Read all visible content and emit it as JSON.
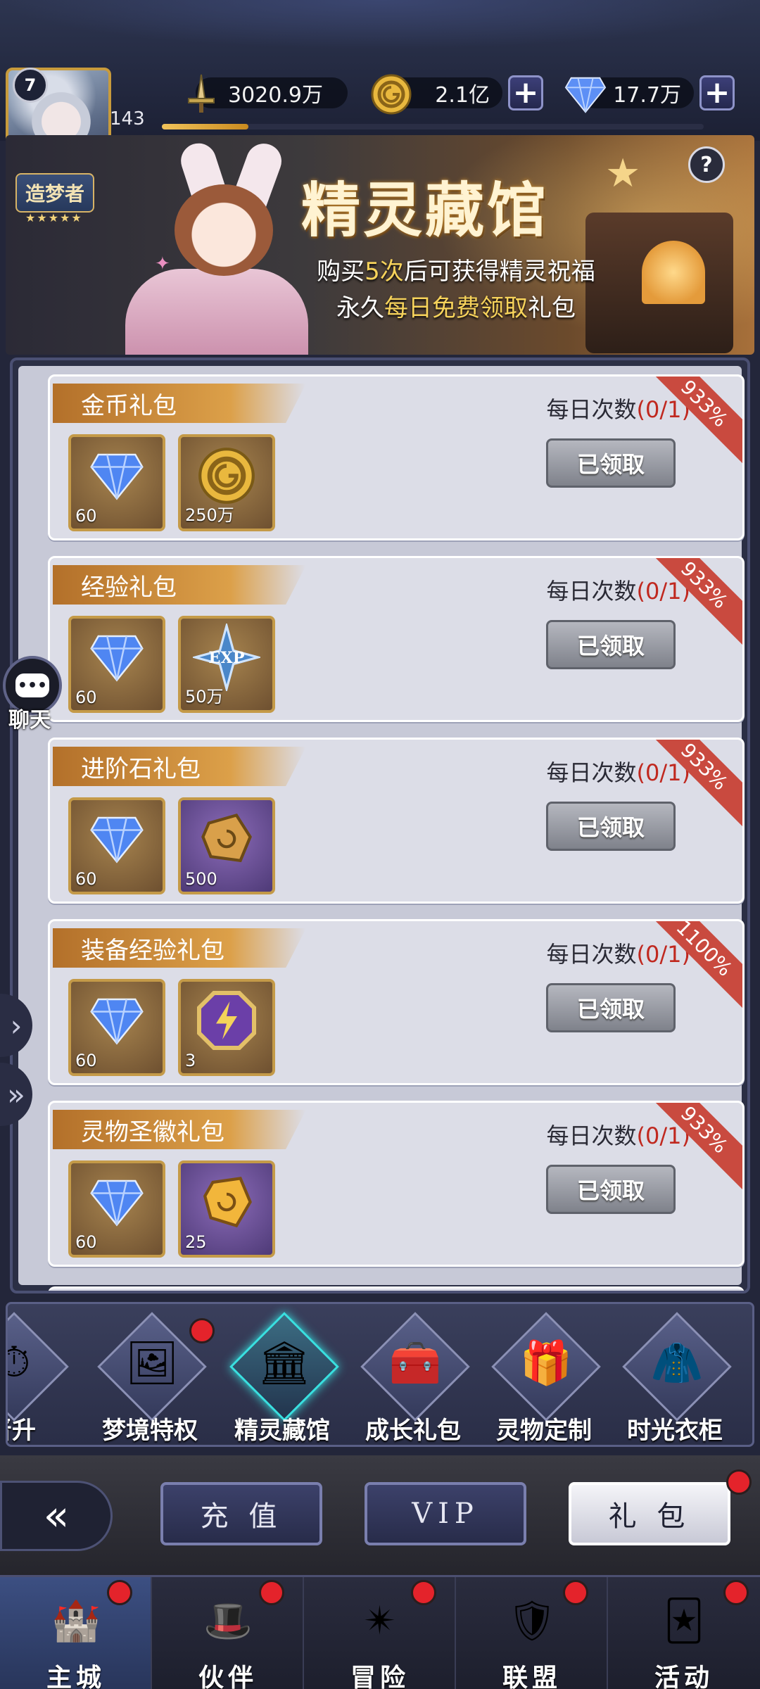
{
  "header": {
    "level": "7",
    "exp_number": "143",
    "exp_progress": 0.16,
    "title_badge": "造梦者",
    "title_stars": "★★★★★",
    "power": "3020.9万",
    "gold": "2.1亿",
    "diamonds": "17.7万",
    "plus": "+"
  },
  "banner": {
    "title": "精灵藏馆",
    "line1_pre": "购买",
    "line1_highlight": "5次",
    "line1_post": "后可获得精灵祝福",
    "line2_pre": "永久",
    "line2_highlight": "每日免费领取",
    "line2_post": "礼包",
    "help": "?"
  },
  "daily_label": "每日次数",
  "claimed_label": "已领取",
  "packs": [
    {
      "name": "金币礼包",
      "count": "(0/1)",
      "ribbon": "933%",
      "items": [
        {
          "icon": "diamond-icon",
          "qty": "60"
        },
        {
          "icon": "gold-coin-icon",
          "qty": "250万"
        }
      ]
    },
    {
      "name": "经验礼包",
      "count": "(0/1)",
      "ribbon": "933%",
      "items": [
        {
          "icon": "diamond-icon",
          "qty": "60"
        },
        {
          "icon": "exp-star-icon",
          "qty": "50万"
        }
      ]
    },
    {
      "name": "进阶石礼包",
      "count": "(0/1)",
      "ribbon": "933%",
      "items": [
        {
          "icon": "diamond-icon",
          "qty": "60"
        },
        {
          "icon": "advance-stone-icon",
          "qty": "500"
        }
      ]
    },
    {
      "name": "装备经验礼包",
      "count": "(0/1)",
      "ribbon": "1100%",
      "items": [
        {
          "icon": "diamond-icon",
          "qty": "60"
        },
        {
          "icon": "lightning-badge-icon",
          "qty": "3"
        }
      ]
    },
    {
      "name": "灵物圣徽礼包",
      "count": "(0/1)",
      "ribbon": "933%",
      "items": [
        {
          "icon": "diamond-icon",
          "qty": "60"
        },
        {
          "icon": "holy-emblem-icon",
          "qty": "25"
        }
      ]
    }
  ],
  "chat": {
    "label": "聊天",
    "bubble": "•••"
  },
  "subtabs": [
    {
      "label": "晋升",
      "active": false,
      "badge": false
    },
    {
      "label": "梦境特权",
      "active": false,
      "badge": true
    },
    {
      "label": "精灵藏馆",
      "active": true,
      "badge": false
    },
    {
      "label": "成长礼包",
      "active": false,
      "badge": false
    },
    {
      "label": "灵物定制",
      "active": false,
      "badge": false
    },
    {
      "label": "时光衣柜",
      "active": false,
      "badge": false
    }
  ],
  "bottom_buttons": {
    "recharge": "充 值",
    "vip": "VIP",
    "gift": "礼 包"
  },
  "main_nav": [
    {
      "label": "主城",
      "active": true
    },
    {
      "label": "伙伴",
      "active": false
    },
    {
      "label": "冒险",
      "active": false
    },
    {
      "label": "联盟",
      "active": false
    },
    {
      "label": "活动",
      "active": false
    }
  ],
  "colors": {
    "accent_gold": "#dca049",
    "count_red": "#c0281f",
    "ribbon_red": "#c94a3f",
    "active_cyan": "#39e0e0",
    "badge_red": "#e4232b"
  }
}
